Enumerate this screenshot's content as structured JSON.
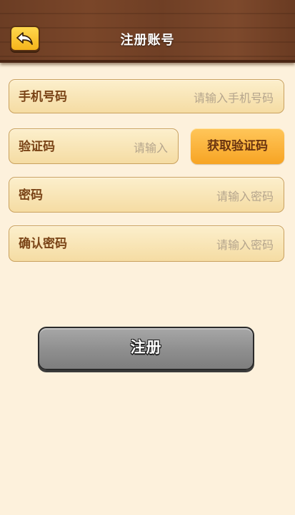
{
  "header": {
    "title": "注册账号",
    "back_icon": "back-arrow-icon"
  },
  "form": {
    "phone": {
      "label": "手机号码",
      "placeholder": "请输入手机号码",
      "value": ""
    },
    "code": {
      "label": "验证码",
      "placeholder": "请输入",
      "value": ""
    },
    "get_code_label": "获取验证码",
    "password": {
      "label": "密码",
      "placeholder": "请输入密码",
      "value": ""
    },
    "confirm_password": {
      "label": "确认密码",
      "placeholder": "请输入密码",
      "value": ""
    }
  },
  "register_label": "注册",
  "colors": {
    "background": "#fdf1dc",
    "header_wood": "#6f3f25",
    "field_fill": "#f5dca3",
    "label_text": "#7a4417",
    "placeholder_text": "#b5a58d",
    "accent_orange": "#f7a423",
    "register_gray": "#8e8e8e"
  }
}
